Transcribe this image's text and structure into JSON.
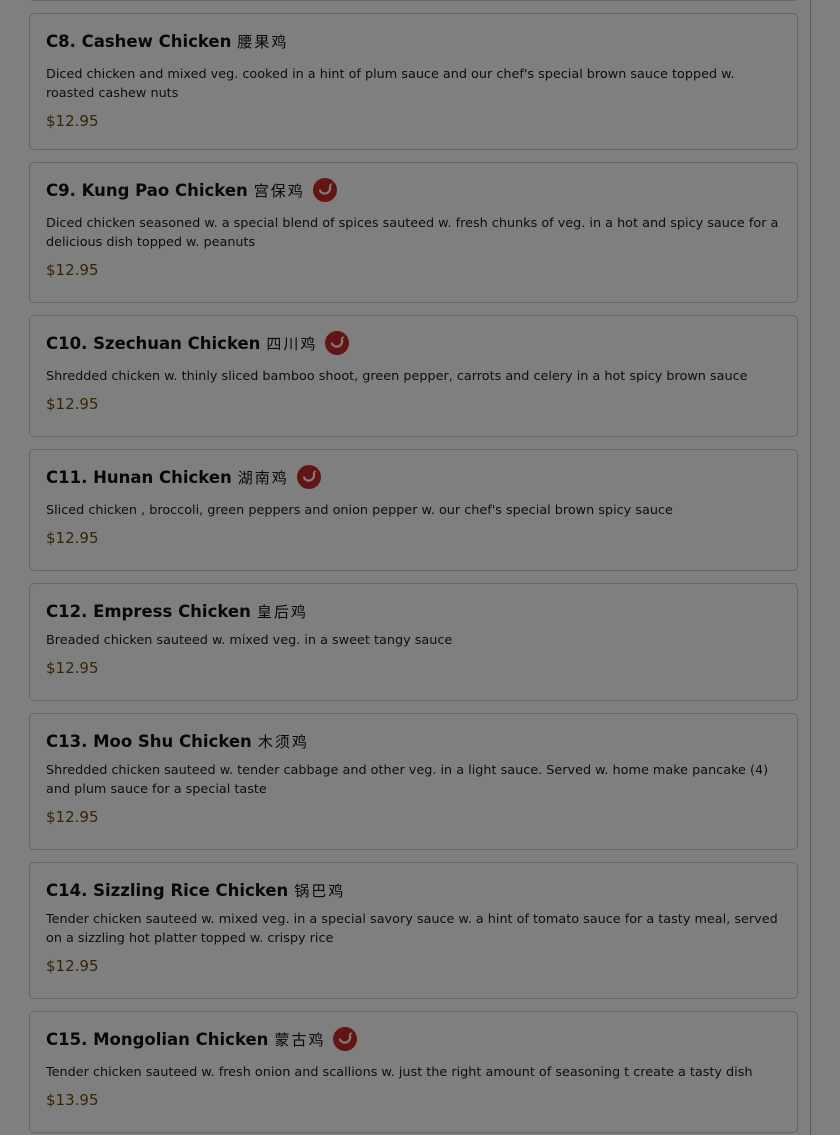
{
  "menu": {
    "items": [
      {
        "code_name": "C8. Cashew Chicken",
        "cjk": "腰果鸡",
        "spicy": false,
        "description": "Diced chicken and mixed veg. cooked in a hint of plum sauce and our chef's special brown sauce topped w. roasted cashew nuts",
        "price": "$12.95"
      },
      {
        "code_name": "C9. Kung Pao Chicken",
        "cjk": "宫保鸡",
        "spicy": true,
        "description": "Diced chicken seasoned w. a special blend of spices sauteed w. fresh chunks of veg. in a hot and spicy sauce for a delicious dish topped w. peanuts",
        "price": "$12.95"
      },
      {
        "code_name": "C10. Szechuan Chicken",
        "cjk": "四川鸡",
        "spicy": true,
        "description": "Shredded chicken w. thinly sliced bamboo shoot, green pepper, carrots and celery in a hot spicy brown sauce",
        "price": "$12.95"
      },
      {
        "code_name": "C11. Hunan Chicken",
        "cjk": "湖南鸡",
        "spicy": true,
        "description": "Sliced chicken , broccoli, green peppers and onion pepper w. our chef's special brown spicy sauce",
        "price": "$12.95"
      },
      {
        "code_name": "C12. Empress Chicken",
        "cjk": "皇后鸡",
        "spicy": false,
        "description": "Breaded chicken sauteed w. mixed veg. in a sweet tangy sauce",
        "price": "$12.95"
      },
      {
        "code_name": "C13. Moo Shu Chicken",
        "cjk": "木须鸡",
        "spicy": false,
        "description": "Shredded chicken sauteed w. tender cabbage and other veg. in a light sauce. Served w. home make pancake (4) and plum sauce for a special taste",
        "price": "$12.95"
      },
      {
        "code_name": "C14. Sizzling Rice Chicken",
        "cjk": "锅巴鸡",
        "spicy": false,
        "description": "Tender chicken sauteed w. mixed veg. in a special savory sauce w. a hint of tomato sauce for a tasty meal, served on a sizzling hot platter topped w. crispy rice",
        "price": "$12.95"
      },
      {
        "code_name": "C15. Mongolian Chicken",
        "cjk": "蒙古鸡",
        "spicy": true,
        "description": "Tender chicken sauteed w. fresh onion and scallions w. just the right amount of seasoning t create a tasty dish",
        "price": "$13.95"
      }
    ]
  },
  "colors": {
    "price": "#6b4a00",
    "spicy_badge": "#c62828",
    "overlay": "rgba(0,0,0,0.5)"
  },
  "icons": {
    "spicy": "chili-pepper-icon"
  }
}
